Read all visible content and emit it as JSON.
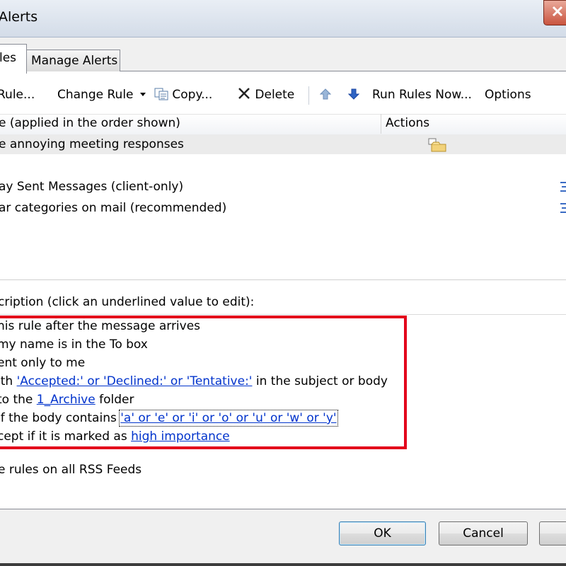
{
  "window": {
    "title": "Alerts"
  },
  "tabs": [
    {
      "label": "les"
    },
    {
      "label": "Manage Alerts"
    }
  ],
  "toolbar": {
    "new_rule": "Rule...",
    "change_rule": "Change Rule",
    "copy": "Copy...",
    "delete": "Delete",
    "run_rules_now": "Run Rules Now...",
    "options": "Options"
  },
  "rules_list": {
    "column_rule": "e (applied in the order shown)",
    "column_actions": "Actions",
    "rows": [
      {
        "label": "e annoying meeting responses"
      },
      {
        "label": "ay Sent Messages  (client-only)"
      },
      {
        "label": "ar categories on mail (recommended)"
      }
    ]
  },
  "description": {
    "header": "cription (click an underlined value to edit):",
    "line1": "his rule after the message arrives",
    "line2": "my name is in the To box",
    "line3": "ent only to me",
    "line4_prefix": "ith ",
    "line4_link": "'Accepted:' or 'Declined:' or 'Tentative:'",
    "line4_suffix": " in the subject or body",
    "line5_prefix": " to the ",
    "line5_link": "1_Archive",
    "line5_suffix": " folder",
    "line6_prefix": " if the body contains ",
    "line6_link": "'a' or 'e' or 'i' or 'o' or 'u' or 'w' or 'y'",
    "line7_prefix": "cept if it is marked as ",
    "line7_link": "high importance"
  },
  "rss_option": "e rules on all RSS Feeds",
  "buttons": {
    "ok": "OK",
    "cancel": "Cancel"
  },
  "colors": {
    "highlight": "#e3001b",
    "link": "#0033cc"
  }
}
